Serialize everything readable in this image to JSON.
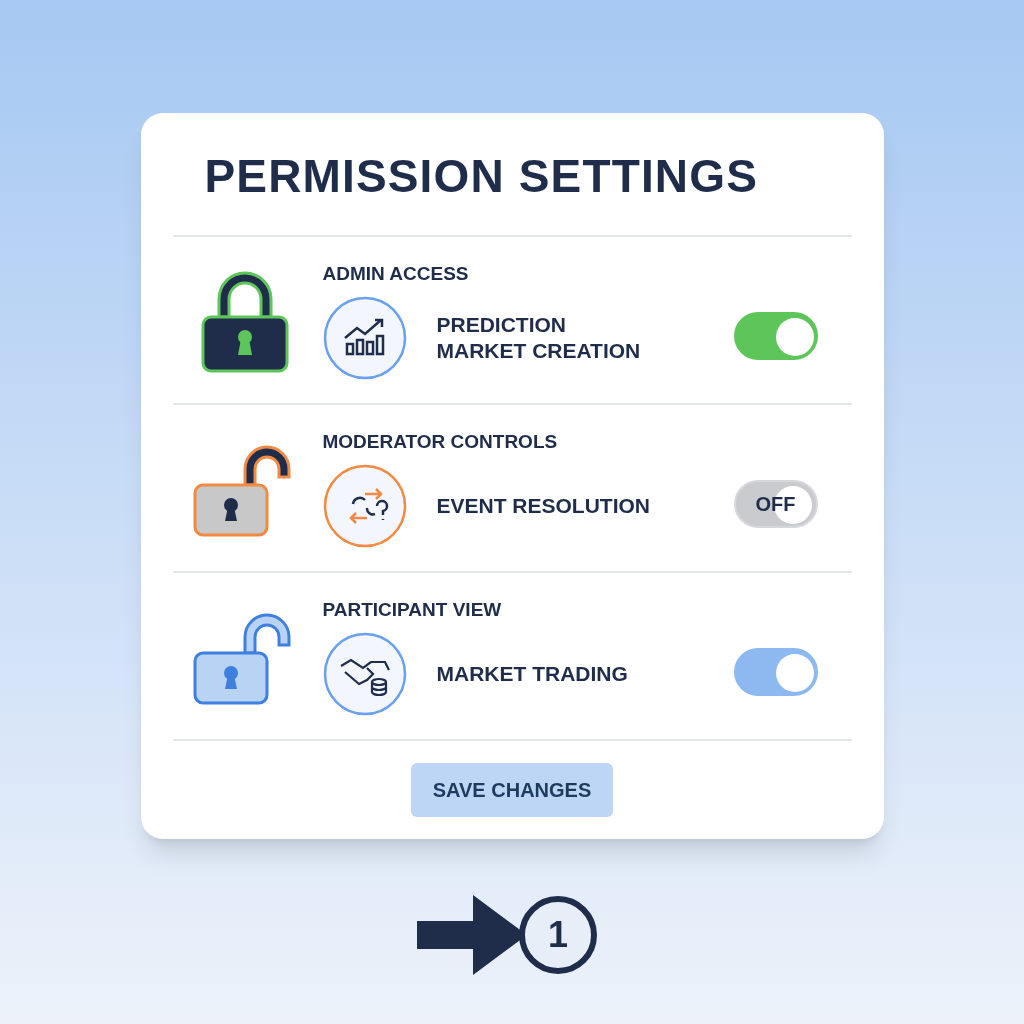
{
  "title": "PERMISSION SETTINGS",
  "rows": [
    {
      "role": "ADMIN ACCESS",
      "locked": true,
      "color": "#5ec55a",
      "feature": [
        "PREDICTION",
        "MARKET CREATION"
      ],
      "toggle": {
        "on": true
      }
    },
    {
      "role": "MODERATOR CONTROLS",
      "locked": false,
      "color": "#f08a44",
      "feature": [
        "EVENT RESOLUTION"
      ],
      "toggle": {
        "on": false,
        "label": "OFF"
      }
    },
    {
      "role": "PARTICIPANT VIEW",
      "locked": false,
      "color": "#3f7fdf",
      "feature": [
        "MARKET TRADING"
      ],
      "toggle": {
        "on": true
      }
    }
  ],
  "save_button": "SAVE CHANGES",
  "step_marker": "1"
}
